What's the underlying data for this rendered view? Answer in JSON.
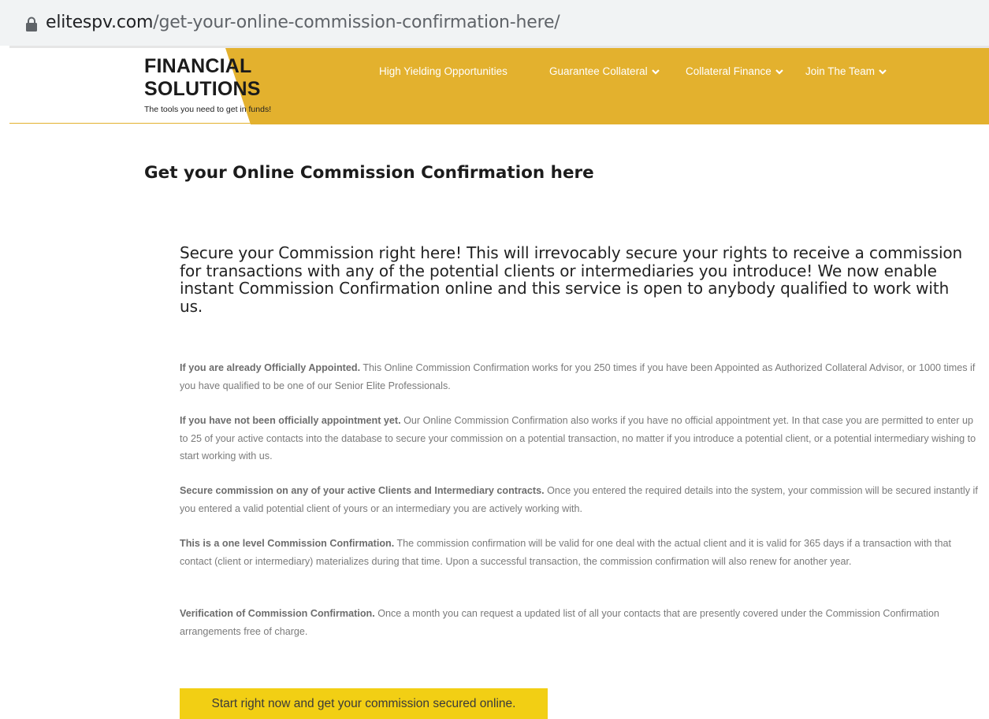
{
  "browser": {
    "url_domain": "elitespv.com",
    "url_path": "/get-your-online-commission-confirmation-here/"
  },
  "header": {
    "brand_line1": "FINANCIAL",
    "brand_line2": "SOLUTIONS",
    "tagline": "The tools you need to get in funds!",
    "accent_color": "#e3b12e",
    "nav": [
      {
        "label": "High Yielding Opportunities",
        "has_dropdown": false
      },
      {
        "label": "Guarantee Collateral",
        "has_dropdown": true
      },
      {
        "label": "Collateral Finance",
        "has_dropdown": true
      },
      {
        "label": "Join The Team",
        "has_dropdown": true
      }
    ]
  },
  "main": {
    "title": "Get your Online Commission Confirmation here",
    "lead": "Secure your Commission right here!  This will irrevocably secure your rights to receive a commission for transactions with any of the potential clients or intermediaries you introduce! We now enable instant Commission Confirmation online and this service is open to anybody qualified to work with us.",
    "paragraphs": [
      {
        "bold": "If you are already Officially Appointed.",
        "text": " This Online Commission Confirmation works for you 250 times if you have been Appointed as Authorized Collateral Advisor, or 1000 times if you have qualified to be one of our Senior Elite Professionals."
      },
      {
        "bold": "If you have not been officially appointment yet.",
        "text": " Our Online Commission Confirmation also works if you have no official appointment yet. In that case you are permitted to enter up to 25 of your active contacts into the database to secure your commission on a potential transaction, no matter if you introduce a potential client, or a potential intermediary wishing to start working with us."
      },
      {
        "bold": "Secure commission on any of your active Clients and Intermediary contracts.",
        "text": " Once you entered the required details into the system, your commission will be secured instantly if you entered a valid potential client of yours or an intermediary you are actively working with."
      },
      {
        "bold": "This is a one level Commission Confirmation.",
        "text": " The commission confirmation will be valid for one deal with the actual client and it is valid for 365 days if a transaction with that contact (client or intermediary) materializes during that time. Upon a successful transaction, the commission confirmation will also renew for another year."
      },
      {
        "bold": "Verification of Commission Confirmation.",
        "text": " Once a month you can request a updated list of all your contacts that are presently covered under the Commission Confirmation arrangements free of charge."
      }
    ],
    "cta_label": "Start right now and get your commission secured online.",
    "cta_color": "#f2cf14"
  }
}
